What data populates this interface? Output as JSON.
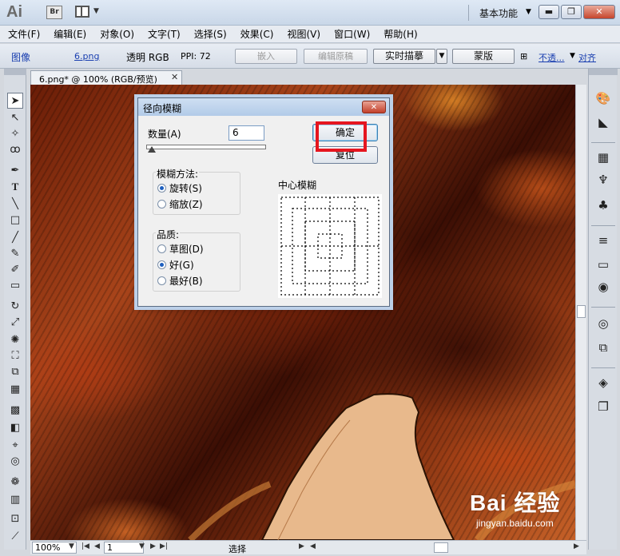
{
  "app": {
    "logo": "Ai",
    "bridge_label": "Br",
    "workspace": "基本功能",
    "win_minimize": "▬",
    "win_restore": "❐",
    "win_close": "✕"
  },
  "menu": [
    "文件(F)",
    "编辑(E)",
    "对象(O)",
    "文字(T)",
    "选择(S)",
    "效果(C)",
    "视图(V)",
    "窗口(W)",
    "帮助(H)"
  ],
  "control": {
    "type_label": "图像",
    "file_link": "6.png",
    "info": "透明 RGB",
    "ppi": "PPI: 72",
    "embed": "嵌入",
    "edit_original": "编辑原稿",
    "live_trace": "实时描摹",
    "mask": "蒙版",
    "opacity_link": "不透...",
    "align_link": "对齐"
  },
  "document": {
    "tab_title": "6.png* @ 100% (RGB/预览)"
  },
  "dialog": {
    "title": "径向模糊",
    "amount_label": "数量(A)",
    "amount_value": "6",
    "ok": "确定",
    "reset": "复位",
    "method_label": "模糊方法:",
    "method_options": [
      {
        "label": "旋转(S)",
        "checked": true
      },
      {
        "label": "缩放(Z)",
        "checked": false
      }
    ],
    "quality_label": "品质:",
    "quality_options": [
      {
        "label": "草图(D)",
        "checked": false
      },
      {
        "label": "好(G)",
        "checked": true
      },
      {
        "label": "最好(B)",
        "checked": false
      }
    ],
    "center_label": "中心模糊"
  },
  "status": {
    "zoom": "100%",
    "artboard": "1",
    "tool_status": "选择"
  },
  "watermark": {
    "main": "Bai 经验",
    "sub": "jingyan.baidu.com"
  },
  "colors": {
    "highlight": "#e5161f",
    "link": "#1a3fb0"
  }
}
